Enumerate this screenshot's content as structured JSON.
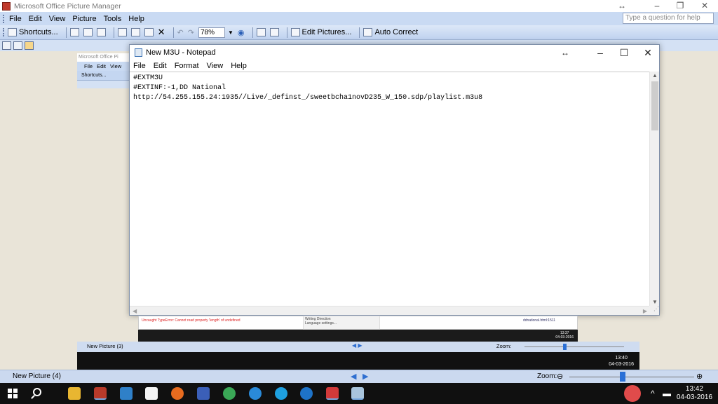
{
  "picture_manager": {
    "title": "Microsoft Office Picture Manager",
    "title_controls": [
      "↔",
      "–",
      "❐",
      "✕"
    ],
    "menu": [
      "File",
      "Edit",
      "View",
      "Picture",
      "Tools",
      "Help"
    ],
    "ask_placeholder": "Type a question for help",
    "toolbar": {
      "shortcuts": "Shortcuts...",
      "zoom_value": "78%",
      "edit_pictures": "Edit Pictures...",
      "auto_correct": "Auto Correct"
    },
    "status": {
      "label": "New Picture (4)",
      "nav_prev": "◀",
      "nav_next": "▶",
      "zoom_label": "Zoom:",
      "zoom_out": "⊖",
      "zoom_in": "⊕",
      "zoom_level": 0.4
    }
  },
  "inner_picture_manager": {
    "title": "Microsoft Office Pi",
    "menu": [
      "File",
      "Edit",
      "View"
    ],
    "shortcuts": "Shortcuts...",
    "status_label": "New Picture (3)",
    "zoom_label": "Zoom:",
    "nav": "◀ ▶",
    "clock_time": "13:40",
    "clock_date": "04-03-2016"
  },
  "nested_screenshot": {
    "error_text": "Uncaught TypeError: Cannot read property 'length' of undefined",
    "menu_item_1": "Writing Direction",
    "menu_item_2": "Language settings...",
    "link_text": "ddnational.html:1511",
    "clock_time": "13:37",
    "clock_date": "04-03-2016"
  },
  "notepad": {
    "title": "New M3U - Notepad",
    "title_controls": [
      "↔",
      "–",
      "☐",
      "✕"
    ],
    "menu": [
      "File",
      "Edit",
      "Format",
      "View",
      "Help"
    ],
    "content": "#EXTM3U\n#EXTINF:-1,DD National\nhttp://54.255.155.24:1935//Live/_definst_/sweetbcha1novD235_W_150.sdp/playlist.m3u8"
  },
  "taskbar": {
    "items": [
      "start-button",
      "search-button",
      "file-explorer",
      "picture-manager",
      "remote-desktop",
      "store",
      "firefox",
      "word",
      "chrome",
      "internet-explorer",
      "skype",
      "edge",
      "photo-app",
      "notepad"
    ],
    "tray_arrow": "^",
    "clock_time": "13:42",
    "clock_date": "04-03-2016"
  },
  "colors": {
    "menu_bar": "#c9daf3",
    "toolbar": "#bfd2ef",
    "taskbar": "#101010",
    "accent": "#2a6fd6"
  }
}
